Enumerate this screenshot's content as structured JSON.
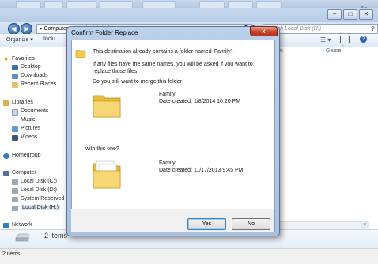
{
  "window": {
    "controls": {
      "minimize": "–",
      "maximize": "□",
      "close": "✕"
    },
    "bg_text_right": "Ac",
    "bg_text_right2": "t"
  },
  "address_bar": {
    "path": "▸ Computer ▸ Local Disk (H:) ▸",
    "search_placeholder": "Search Local Disk (H:)",
    "search_icon": "search-icon"
  },
  "toolbar": {
    "organize": "Organize ▾",
    "include": "Inclu"
  },
  "nav_pane": {
    "favorites_header": "Favorites",
    "favorites": [
      "Desktop",
      "Downloads",
      "Recent Places"
    ],
    "libraries_header": "Libraries",
    "libraries": [
      "Documents",
      "Music",
      "Pictures",
      "Videos"
    ],
    "homegroup": "Homegroup",
    "computer_header": "Computer",
    "drives": [
      "Local Disk (C:)",
      "Local Disk (D:)",
      "System Reserved",
      "Local Disk (H:)"
    ],
    "network": "Network"
  },
  "content": {
    "col_header_m": "m",
    "col_header_genre": "Genre"
  },
  "details_pane": {
    "item_count": "2 items"
  },
  "statusbar": {
    "text": "2 items"
  },
  "dialog": {
    "title": "Confirm Folder Replace",
    "close_label": "x",
    "line1": "This destination already contains a folder named 'Family'.",
    "line2": "If any files have the same names, you will be asked if you want to replace those files.",
    "line3": "Do you still want to merge this folder",
    "source_name": "Family",
    "source_date": "Date created: 1/8/2014 10:20 PM",
    "with_label": "with this one?",
    "dest_name": "Family",
    "dest_date": "Date created: 11/17/2013 9:45 PM",
    "yes_label": "Yes",
    "no_label": "No"
  },
  "colors": {
    "folder_yellow": "#f2c94c",
    "titlebar_blue": "#b9cfe9",
    "close_red": "#c4432b"
  }
}
